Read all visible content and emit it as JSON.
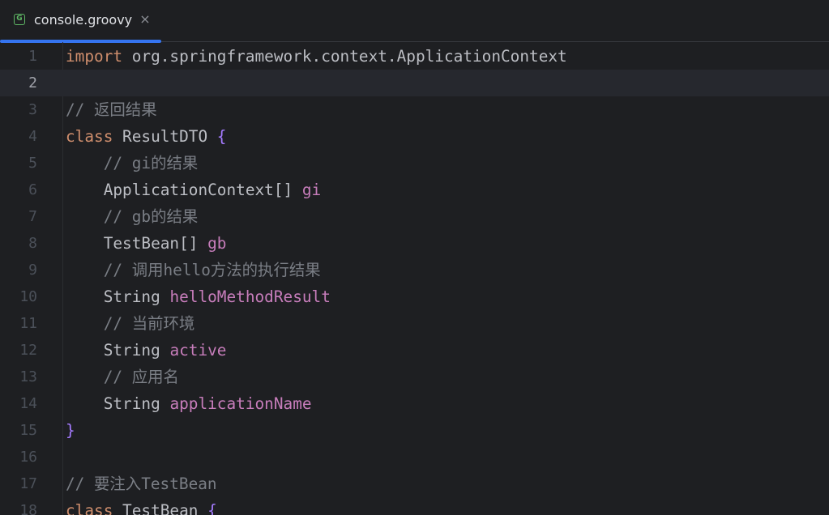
{
  "tab": {
    "label": "console.groovy",
    "icon": "groovy-file-icon",
    "icon_letter": "G",
    "close_glyph": "×"
  },
  "editor": {
    "current_line": 2,
    "lines": [
      {
        "number": "1",
        "tokens": [
          {
            "t": "keyword",
            "v": "import"
          },
          {
            "t": "plain",
            "v": " org.springframework.context.ApplicationContext"
          }
        ]
      },
      {
        "number": "2",
        "tokens": []
      },
      {
        "number": "3",
        "tokens": [
          {
            "t": "comment",
            "v": "// 返回结果"
          }
        ]
      },
      {
        "number": "4",
        "tokens": [
          {
            "t": "keyword",
            "v": "class"
          },
          {
            "t": "plain",
            "v": " ResultDTO "
          },
          {
            "t": "brace",
            "v": "{"
          }
        ]
      },
      {
        "number": "5",
        "tokens": [
          {
            "t": "indent",
            "v": "    "
          },
          {
            "t": "comment",
            "v": "// gi的结果"
          }
        ]
      },
      {
        "number": "6",
        "tokens": [
          {
            "t": "indent",
            "v": "    "
          },
          {
            "t": "plain",
            "v": "ApplicationContext[] "
          },
          {
            "t": "field",
            "v": "gi"
          }
        ]
      },
      {
        "number": "7",
        "tokens": [
          {
            "t": "indent",
            "v": "    "
          },
          {
            "t": "comment",
            "v": "// gb的结果"
          }
        ]
      },
      {
        "number": "8",
        "tokens": [
          {
            "t": "indent",
            "v": "    "
          },
          {
            "t": "plain",
            "v": "TestBean[] "
          },
          {
            "t": "field",
            "v": "gb"
          }
        ]
      },
      {
        "number": "9",
        "tokens": [
          {
            "t": "indent",
            "v": "    "
          },
          {
            "t": "comment",
            "v": "// 调用hello方法的执行结果"
          }
        ]
      },
      {
        "number": "10",
        "tokens": [
          {
            "t": "indent",
            "v": "    "
          },
          {
            "t": "plain",
            "v": "String "
          },
          {
            "t": "field",
            "v": "helloMethodResult"
          }
        ]
      },
      {
        "number": "11",
        "tokens": [
          {
            "t": "indent",
            "v": "    "
          },
          {
            "t": "comment",
            "v": "// 当前环境"
          }
        ]
      },
      {
        "number": "12",
        "tokens": [
          {
            "t": "indent",
            "v": "    "
          },
          {
            "t": "plain",
            "v": "String "
          },
          {
            "t": "field",
            "v": "active"
          }
        ]
      },
      {
        "number": "13",
        "tokens": [
          {
            "t": "indent",
            "v": "    "
          },
          {
            "t": "comment",
            "v": "// 应用名"
          }
        ]
      },
      {
        "number": "14",
        "tokens": [
          {
            "t": "indent",
            "v": "    "
          },
          {
            "t": "plain",
            "v": "String "
          },
          {
            "t": "field",
            "v": "applicationName"
          }
        ]
      },
      {
        "number": "15",
        "tokens": [
          {
            "t": "brace",
            "v": "}"
          }
        ]
      },
      {
        "number": "16",
        "tokens": []
      },
      {
        "number": "17",
        "tokens": [
          {
            "t": "comment",
            "v": "// 要注入TestBean"
          }
        ]
      },
      {
        "number": "18",
        "tokens": [
          {
            "t": "keyword",
            "v": "class"
          },
          {
            "t": "plain",
            "v": " TestBean "
          },
          {
            "t": "brace",
            "v": "{"
          }
        ]
      }
    ]
  },
  "colors": {
    "background": "#1e1f22",
    "current_line": "#26282e",
    "tab_accent": "#3574f0",
    "keyword": "#cf8e6d",
    "comment": "#7a7e85",
    "field": "#c77dbb",
    "brace": "#a57bff",
    "plain": "#bcbec4",
    "line_number": "#4b5059"
  }
}
